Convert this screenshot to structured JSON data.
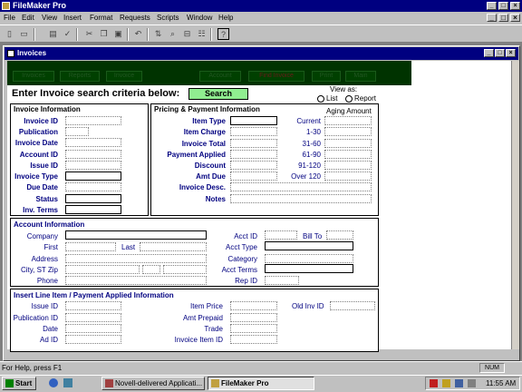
{
  "app": {
    "title": "FileMaker Pro"
  },
  "menu": [
    "File",
    "Edit",
    "View",
    "Insert",
    "Format",
    "Requests",
    "Scripts",
    "Window",
    "Help"
  ],
  "toolbar": {
    "icons": [
      "new-icon",
      "open-icon",
      "save-icon",
      "print-icon",
      "print-preview-icon",
      "spelling-icon",
      "cut-icon",
      "copy-icon",
      "paste-icon",
      "undo-icon",
      "sort-icon",
      "find-icon",
      "omit-icon",
      "show-all-icon",
      "define-fields-icon",
      "help-icon"
    ]
  },
  "doc": {
    "title": "Invoices"
  },
  "nav_tabs": [
    "Invoices",
    "Reports",
    "Invoice",
    "Account",
    "Find Invoice",
    "Print",
    "Main"
  ],
  "search": {
    "label": "Enter Invoice search criteria below:",
    "button": "Search"
  },
  "view_as": {
    "label": "View as:",
    "list": "List",
    "report": "Report",
    "selected": "List"
  },
  "invoice_info": {
    "title": "Invoice Information",
    "fields": [
      "Invoice ID",
      "Publication",
      "Invoice Date",
      "Account ID",
      "Issue ID",
      "Invoice Type",
      "Due Date",
      "Status",
      "Inv. Terms"
    ]
  },
  "pricing": {
    "title": "Pricing & Payment Information",
    "fields": [
      "Item Type",
      "Item Charge",
      "Invoice Total",
      "Payment Applied",
      "Discount",
      "Amt Due",
      "Invoice Desc.",
      "Notes"
    ],
    "aging_title": "Aging Amount",
    "aging": [
      "Current",
      "1-30",
      "31-60",
      "61-90",
      "91-120",
      "Over 120"
    ]
  },
  "account": {
    "title": "Account Information",
    "left": [
      "Company",
      "First",
      "Address",
      "City, ST Zip",
      "Phone"
    ],
    "last_label": "Last",
    "acct_id": "Acct ID",
    "bill_to": "Bill To",
    "right": [
      "Acct Type",
      "Category",
      "Acct Terms",
      "Rep ID"
    ]
  },
  "line_item": {
    "title": "Insert Line Item / Payment Applied Information",
    "left": [
      "Issue ID",
      "Publication ID",
      "Date",
      "Ad ID"
    ],
    "mid": [
      "Item Price",
      "Amt Prepaid",
      "Trade",
      "Invoice Item ID"
    ],
    "old_inv": "Old Inv ID"
  },
  "status": {
    "text": "For Help, press F1",
    "num": "NUM"
  },
  "taskbar": {
    "start": "Start",
    "tasks": [
      "Novell-delivered Applicati...",
      "FileMaker Pro"
    ],
    "clock": "11:55 AM"
  },
  "colors": {
    "titlebar": "#000080",
    "header_green": "#003300",
    "search_button": "#90ee90",
    "section_title": "#000080"
  }
}
